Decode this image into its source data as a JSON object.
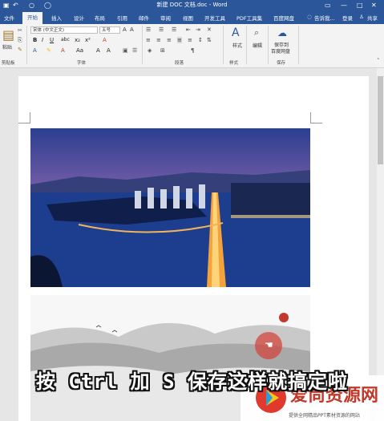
{
  "window": {
    "title": "新建 DOC 文档.doc - Word"
  },
  "quick_access": [
    "save-icon",
    "undo-icon",
    "redo-icon",
    "customize-icon"
  ],
  "tabs": [
    "文件",
    "开始",
    "插入",
    "设计",
    "布局",
    "引用",
    "邮件",
    "审阅",
    "视图",
    "开发工具",
    "PDF工具集",
    "百度网盘"
  ],
  "tell_me": "告诉我...",
  "account": {
    "login": "登录",
    "share": "共享"
  },
  "ribbon": {
    "clipboard": {
      "paste": "粘贴",
      "group": "剪贴板"
    },
    "font": {
      "name": "宋体 (中文正文)",
      "size": "五号",
      "group": "字体",
      "buttons": [
        "B",
        "I",
        "U",
        "abc",
        "x₂",
        "x²",
        "A",
        "Aa",
        "A",
        "A"
      ]
    },
    "paragraph": {
      "group": "段落"
    },
    "styles": {
      "label": "样式",
      "group": "样式"
    },
    "editing": {
      "label": "编辑"
    },
    "save": {
      "label1": "保存到",
      "label2": "百度网盘",
      "group": "保存"
    }
  },
  "overlay": {
    "caption": "按 Ctrl 加 S 保存这样就搞定啦",
    "watermark_title": "爱尚资源网",
    "watermark_sub": "提供全网精品PPT素材资源的网站"
  },
  "colors": {
    "brand": "#2b579a",
    "accent": "#c0392b"
  }
}
